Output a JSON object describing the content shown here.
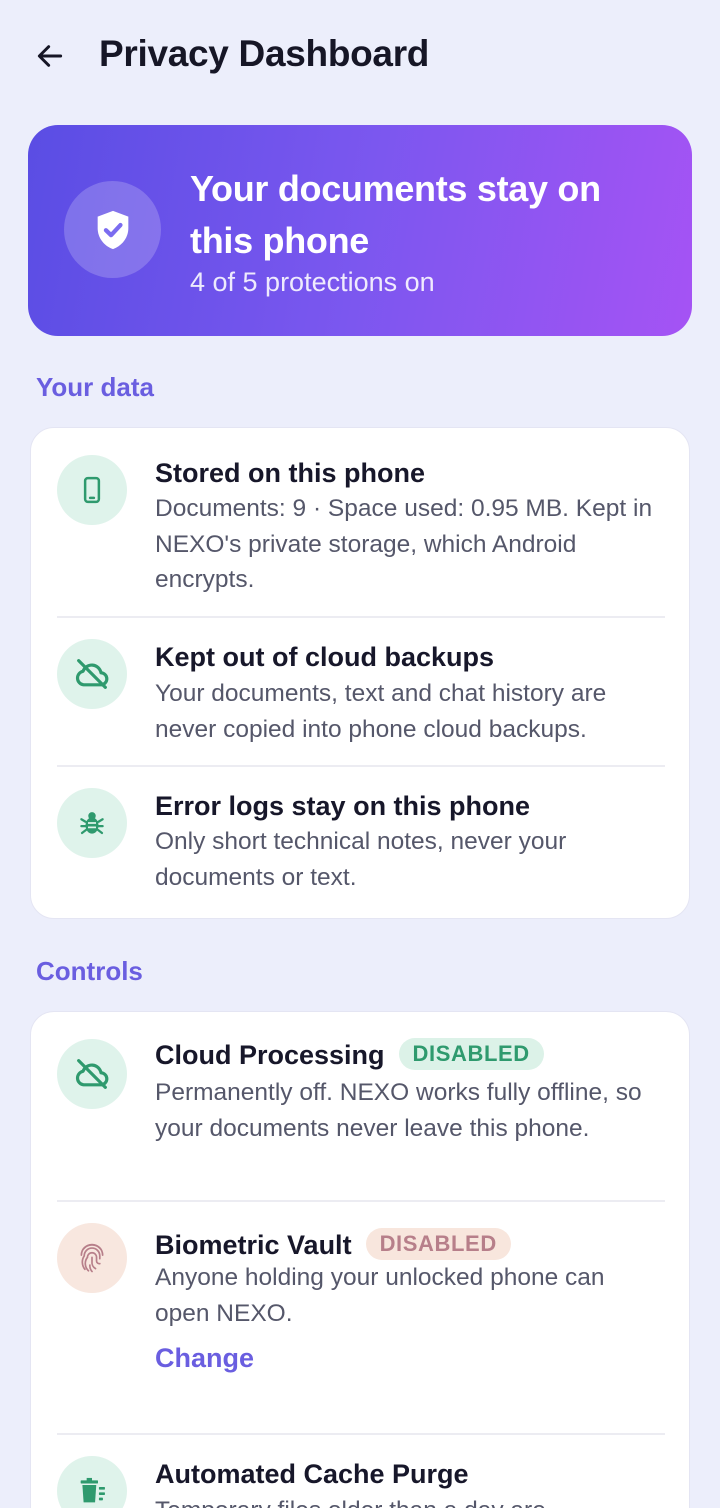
{
  "header": {
    "title": "Privacy Dashboard",
    "back_icon": "arrow-left-icon"
  },
  "hero": {
    "title": "Your documents stay on this phone",
    "subtitle": "4 of 5 protections on",
    "icon": "shield-check-icon"
  },
  "your_data": {
    "label": "Your data",
    "items": [
      {
        "icon": "phone-icon",
        "title": "Stored on this phone",
        "description": "Documents: 9 · Space used: 0.95 MB. Kept in NEXO's private storage, which Android encrypts."
      },
      {
        "icon": "cloud-off-icon",
        "title": "Kept out of cloud backups",
        "description": "Your documents, text and chat history are never copied into phone cloud backups."
      },
      {
        "icon": "bug-icon",
        "title": "Error logs stay on this phone",
        "description": "Only short technical notes, never your documents or text."
      }
    ]
  },
  "controls": {
    "label": "Controls",
    "items": [
      {
        "icon": "cloud-off-icon",
        "title": "Cloud Processing",
        "badge": "DISABLED",
        "description": "Permanently off. NEXO works fully offline, so your documents never leave this phone."
      },
      {
        "icon": "fingerprint-icon",
        "title": "Biometric Vault",
        "badge": "DISABLED",
        "description": "Anyone holding your unlocked phone can open NEXO.",
        "action": "Change"
      },
      {
        "icon": "trash-icon",
        "title": "Automated Cache Purge",
        "description": "Temporary files older than a day are"
      }
    ]
  },
  "colors": {
    "background": "#eceefb",
    "accent": "#6a5ee0",
    "hero_gradient_start": "#5a4de4",
    "hero_gradient_end": "#a553f4",
    "success": "#2f9a6e",
    "warning": "#b77f8a"
  }
}
